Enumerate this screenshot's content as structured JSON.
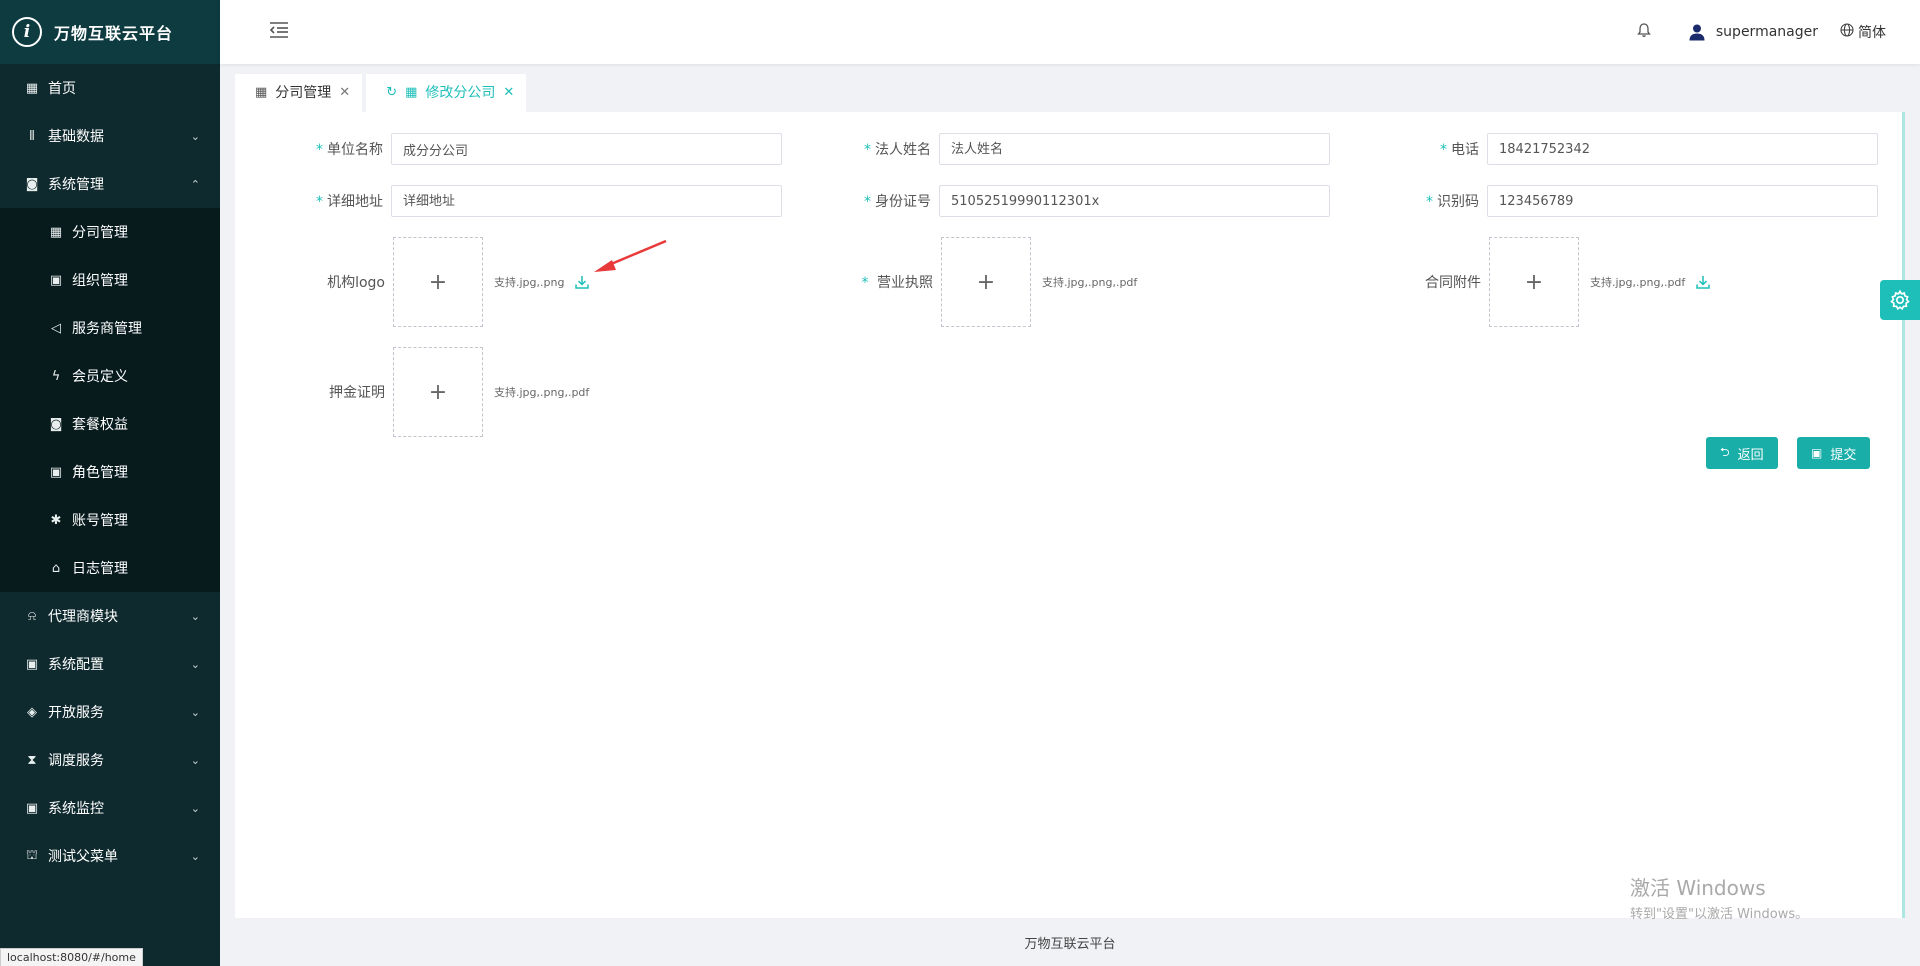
{
  "brand": {
    "logo_char": "i",
    "title": "万物互联云平台"
  },
  "sidebar": {
    "items": [
      {
        "label": "首页",
        "icon": "calendar-icon",
        "glyph": "▦"
      },
      {
        "label": "基础数据",
        "icon": "barcode-icon",
        "glyph": "⦀",
        "arrow": "⌄"
      },
      {
        "label": "系统管理",
        "icon": "camera-icon",
        "glyph": "◙",
        "arrow": "⌃"
      }
    ],
    "sub_items": [
      {
        "label": "分司管理",
        "icon": "calendar-icon",
        "glyph": "▦"
      },
      {
        "label": "组织管理",
        "icon": "grid-icon",
        "glyph": "▣"
      },
      {
        "label": "服务商管理",
        "icon": "speaker-icon",
        "glyph": "◁"
      },
      {
        "label": "会员定义",
        "icon": "lightning-icon",
        "glyph": "ϟ"
      },
      {
        "label": "套餐权益",
        "icon": "camera-icon",
        "glyph": "◙"
      },
      {
        "label": "角色管理",
        "icon": "grid-icon",
        "glyph": "▣"
      },
      {
        "label": "账号管理",
        "icon": "bug-icon",
        "glyph": "✱"
      },
      {
        "label": "日志管理",
        "icon": "home-icon",
        "glyph": "⌂"
      }
    ],
    "items_after": [
      {
        "label": "代理商模块",
        "icon": "bell-icon",
        "glyph": "⍾",
        "arrow": "⌄"
      },
      {
        "label": "系统配置",
        "icon": "grid-icon",
        "glyph": "▣",
        "arrow": "⌄"
      },
      {
        "label": "开放服务",
        "icon": "tag-icon",
        "glyph": "◈",
        "arrow": "⌄"
      },
      {
        "label": "调度服务",
        "icon": "hourglass-icon",
        "glyph": "⧗",
        "arrow": "⌄"
      },
      {
        "label": "系统监控",
        "icon": "grid-icon",
        "glyph": "▣",
        "arrow": "⌄"
      },
      {
        "label": "测试父菜单",
        "icon": "bank-icon",
        "glyph": "⛫",
        "arrow": "⌄"
      }
    ]
  },
  "header": {
    "username": "supermanager",
    "language": "简体"
  },
  "tabs": [
    {
      "label": "分司管理",
      "active": false
    },
    {
      "label": "修改分公司",
      "active": true
    }
  ],
  "form": {
    "company_name": {
      "label": "单位名称",
      "value": "成分分公司"
    },
    "legal_person": {
      "label": "法人姓名",
      "placeholder": "法人姓名"
    },
    "phone": {
      "label": "电话",
      "value": "18421752342"
    },
    "address": {
      "label": "详细地址",
      "placeholder": "详细地址"
    },
    "id_card": {
      "label": "身份证号",
      "value": "51052519990112301x"
    },
    "code": {
      "label": "识别码",
      "value": "123456789"
    },
    "logo": {
      "label": "机构logo",
      "hint": "支持.jpg,.png"
    },
    "license": {
      "label": "营业执照",
      "hint": "支持.jpg,.png,.pdf"
    },
    "contract": {
      "label": "合同附件",
      "hint": "支持.jpg,.png,.pdf"
    },
    "deposit": {
      "label": "押金证明",
      "hint": "支持.jpg,.png,.pdf"
    },
    "required_mark": "*",
    "plus": "+"
  },
  "buttons": {
    "back": "返回",
    "submit": "提交"
  },
  "footer": {
    "text": "万物互联云平台"
  },
  "watermark": {
    "line1": "激活 Windows",
    "line2": "转到\"设置\"以激活 Windows。"
  },
  "statusbar": {
    "url": "localhost:8080/#/home"
  },
  "colors": {
    "accent": "#1dbfb8",
    "sidebar_bg": "#0f2a2e",
    "button_bg": "#1aaea8"
  }
}
